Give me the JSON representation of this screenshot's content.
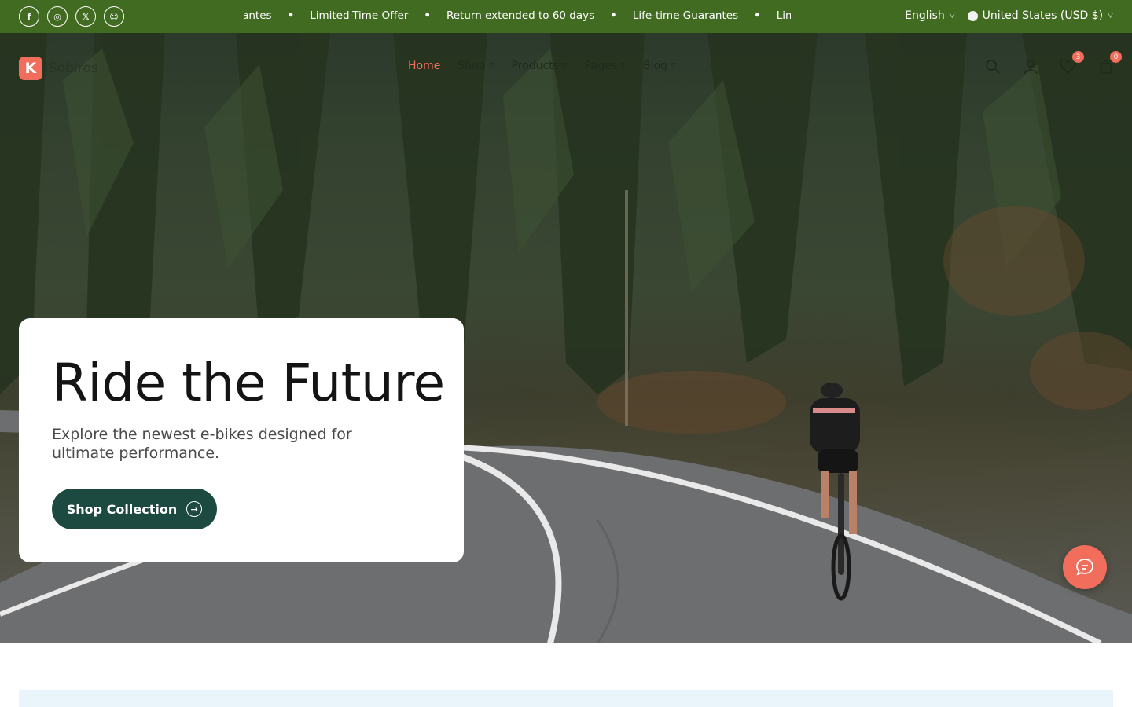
{
  "topbar": {
    "socials": [
      {
        "icon": "facebook-icon",
        "glyph": "f"
      },
      {
        "icon": "instagram-icon",
        "glyph": "◎"
      },
      {
        "icon": "x-icon",
        "glyph": "𝕏"
      },
      {
        "icon": "snapchat-icon",
        "glyph": "☺"
      }
    ],
    "ticker": [
      "urantes",
      "Limited-Time Offer",
      "Return extended to 60 days",
      "Life-time Guarantes",
      "Limite"
    ],
    "language": "English",
    "currency": "United States (USD $)"
  },
  "header": {
    "logo_letter": "K",
    "logo_text": "Sobiros",
    "nav": [
      {
        "label": "Home",
        "active": true
      },
      {
        "label": "Shop",
        "active": false
      },
      {
        "label": "Products",
        "active": false
      },
      {
        "label": "Pages",
        "active": false
      },
      {
        "label": "Blog",
        "active": false
      }
    ],
    "wishlist_count": "3",
    "cart_count": "0"
  },
  "hero": {
    "title": "Ride the Future",
    "subtitle": "Explore the newest e-bikes designed for ultimate performance.",
    "cta_label": "Shop Collection"
  },
  "colors": {
    "topbar": "#426b22",
    "accent": "#f26d5b",
    "cta": "#1d4a40"
  }
}
